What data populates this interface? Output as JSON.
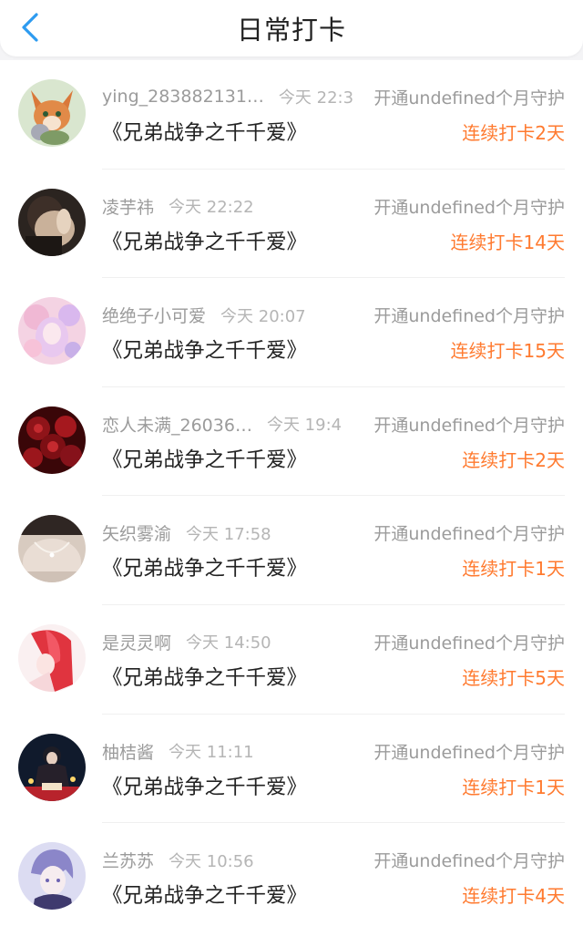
{
  "header": {
    "title": "日常打卡",
    "back_icon": "chevron-left-icon",
    "accent": "#2d9bf0"
  },
  "colors": {
    "streak": "#ff7a2f",
    "muted_text": "#9b9b9b"
  },
  "entries": [
    {
      "username": "ying_283882131…",
      "time": "今天 22:3",
      "note": "开通undefined个月守护",
      "title": "《兄弟战争之千千爱》",
      "streak": "连续打卡2天",
      "avatar": "cartoon-fox-avatar"
    },
    {
      "username": "凌芋祎",
      "time": "今天 22:22",
      "note": "开通undefined个月守护",
      "title": "《兄弟战争之千千爱》",
      "streak": "连续打卡14天",
      "avatar": "dark-photo-avatar"
    },
    {
      "username": "绝绝子小可爱",
      "time": "今天 20:07",
      "note": "开通undefined个月守护",
      "title": "《兄弟战争之千千爱》",
      "streak": "连续打卡15天",
      "avatar": "pink-anime-avatar"
    },
    {
      "username": "恋人未满_26036…",
      "time": "今天 19:4",
      "note": "开通undefined个月守护",
      "title": "《兄弟战争之千千爱》",
      "streak": "连续打卡2天",
      "avatar": "red-roses-avatar"
    },
    {
      "username": "矢织雾渝",
      "time": "今天 17:58",
      "note": "开通undefined个月守护",
      "title": "《兄弟战争之千千爱》",
      "streak": "连续打卡1天",
      "avatar": "necklace-photo-avatar"
    },
    {
      "username": "是灵灵啊",
      "time": "今天 14:50",
      "note": "开通undefined个月守护",
      "title": "《兄弟战争之千千爱》",
      "streak": "连续打卡5天",
      "avatar": "red-hair-anime-avatar"
    },
    {
      "username": "柚桔酱",
      "time": "今天 11:11",
      "note": "开通undefined个月守护",
      "title": "《兄弟战争之千千爱》",
      "streak": "连续打卡1天",
      "avatar": "dark-anime-avatar"
    },
    {
      "username": "兰苏苏",
      "time": "今天 10:56",
      "note": "开通undefined个月守护",
      "title": "《兄弟战争之千千爱》",
      "streak": "连续打卡4天",
      "avatar": "purple-anime-avatar"
    }
  ]
}
